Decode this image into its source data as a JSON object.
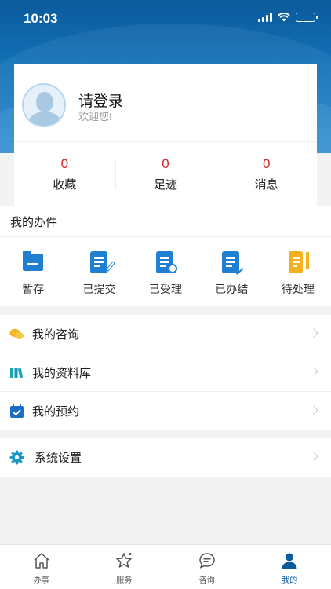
{
  "status_bar": {
    "time": "10:03"
  },
  "profile": {
    "title": "请登录",
    "subtitle": "欢迎您!"
  },
  "stats": [
    {
      "value": "0",
      "label": "收藏"
    },
    {
      "value": "0",
      "label": "足迹"
    },
    {
      "value": "0",
      "label": "消息"
    }
  ],
  "my_tasks": {
    "header": "我的办件",
    "items": [
      {
        "label": "暂存",
        "icon": "folder-icon"
      },
      {
        "label": "已提交",
        "icon": "document-edit-icon"
      },
      {
        "label": "已受理",
        "icon": "document-clock-icon"
      },
      {
        "label": "已办结",
        "icon": "document-check-icon"
      },
      {
        "label": "待处理",
        "icon": "document-pending-icon"
      }
    ]
  },
  "menu": {
    "items": [
      {
        "label": "我的咨询",
        "icon": "chat-bubbles-icon"
      },
      {
        "label": "我的资料库",
        "icon": "library-icon"
      },
      {
        "label": "我的预约",
        "icon": "calendar-check-icon"
      }
    ]
  },
  "settings": {
    "label": "系统设置",
    "icon": "gear-icon"
  },
  "tabbar": {
    "items": [
      {
        "label": "办事",
        "icon": "home-icon"
      },
      {
        "label": "服务",
        "icon": "star-icon"
      },
      {
        "label": "咨询",
        "icon": "chat-icon"
      },
      {
        "label": "我的",
        "icon": "user-icon",
        "active": true
      }
    ]
  },
  "colors": {
    "primary": "#1f7fd1",
    "header_dark": "#0a5a9c",
    "count_red": "#d42424",
    "pending_yellow": "#f2b11d",
    "chat_yellow": "#f2b11d",
    "library_teal": "#1aa7a8",
    "settings_teal": "#1899c9"
  }
}
